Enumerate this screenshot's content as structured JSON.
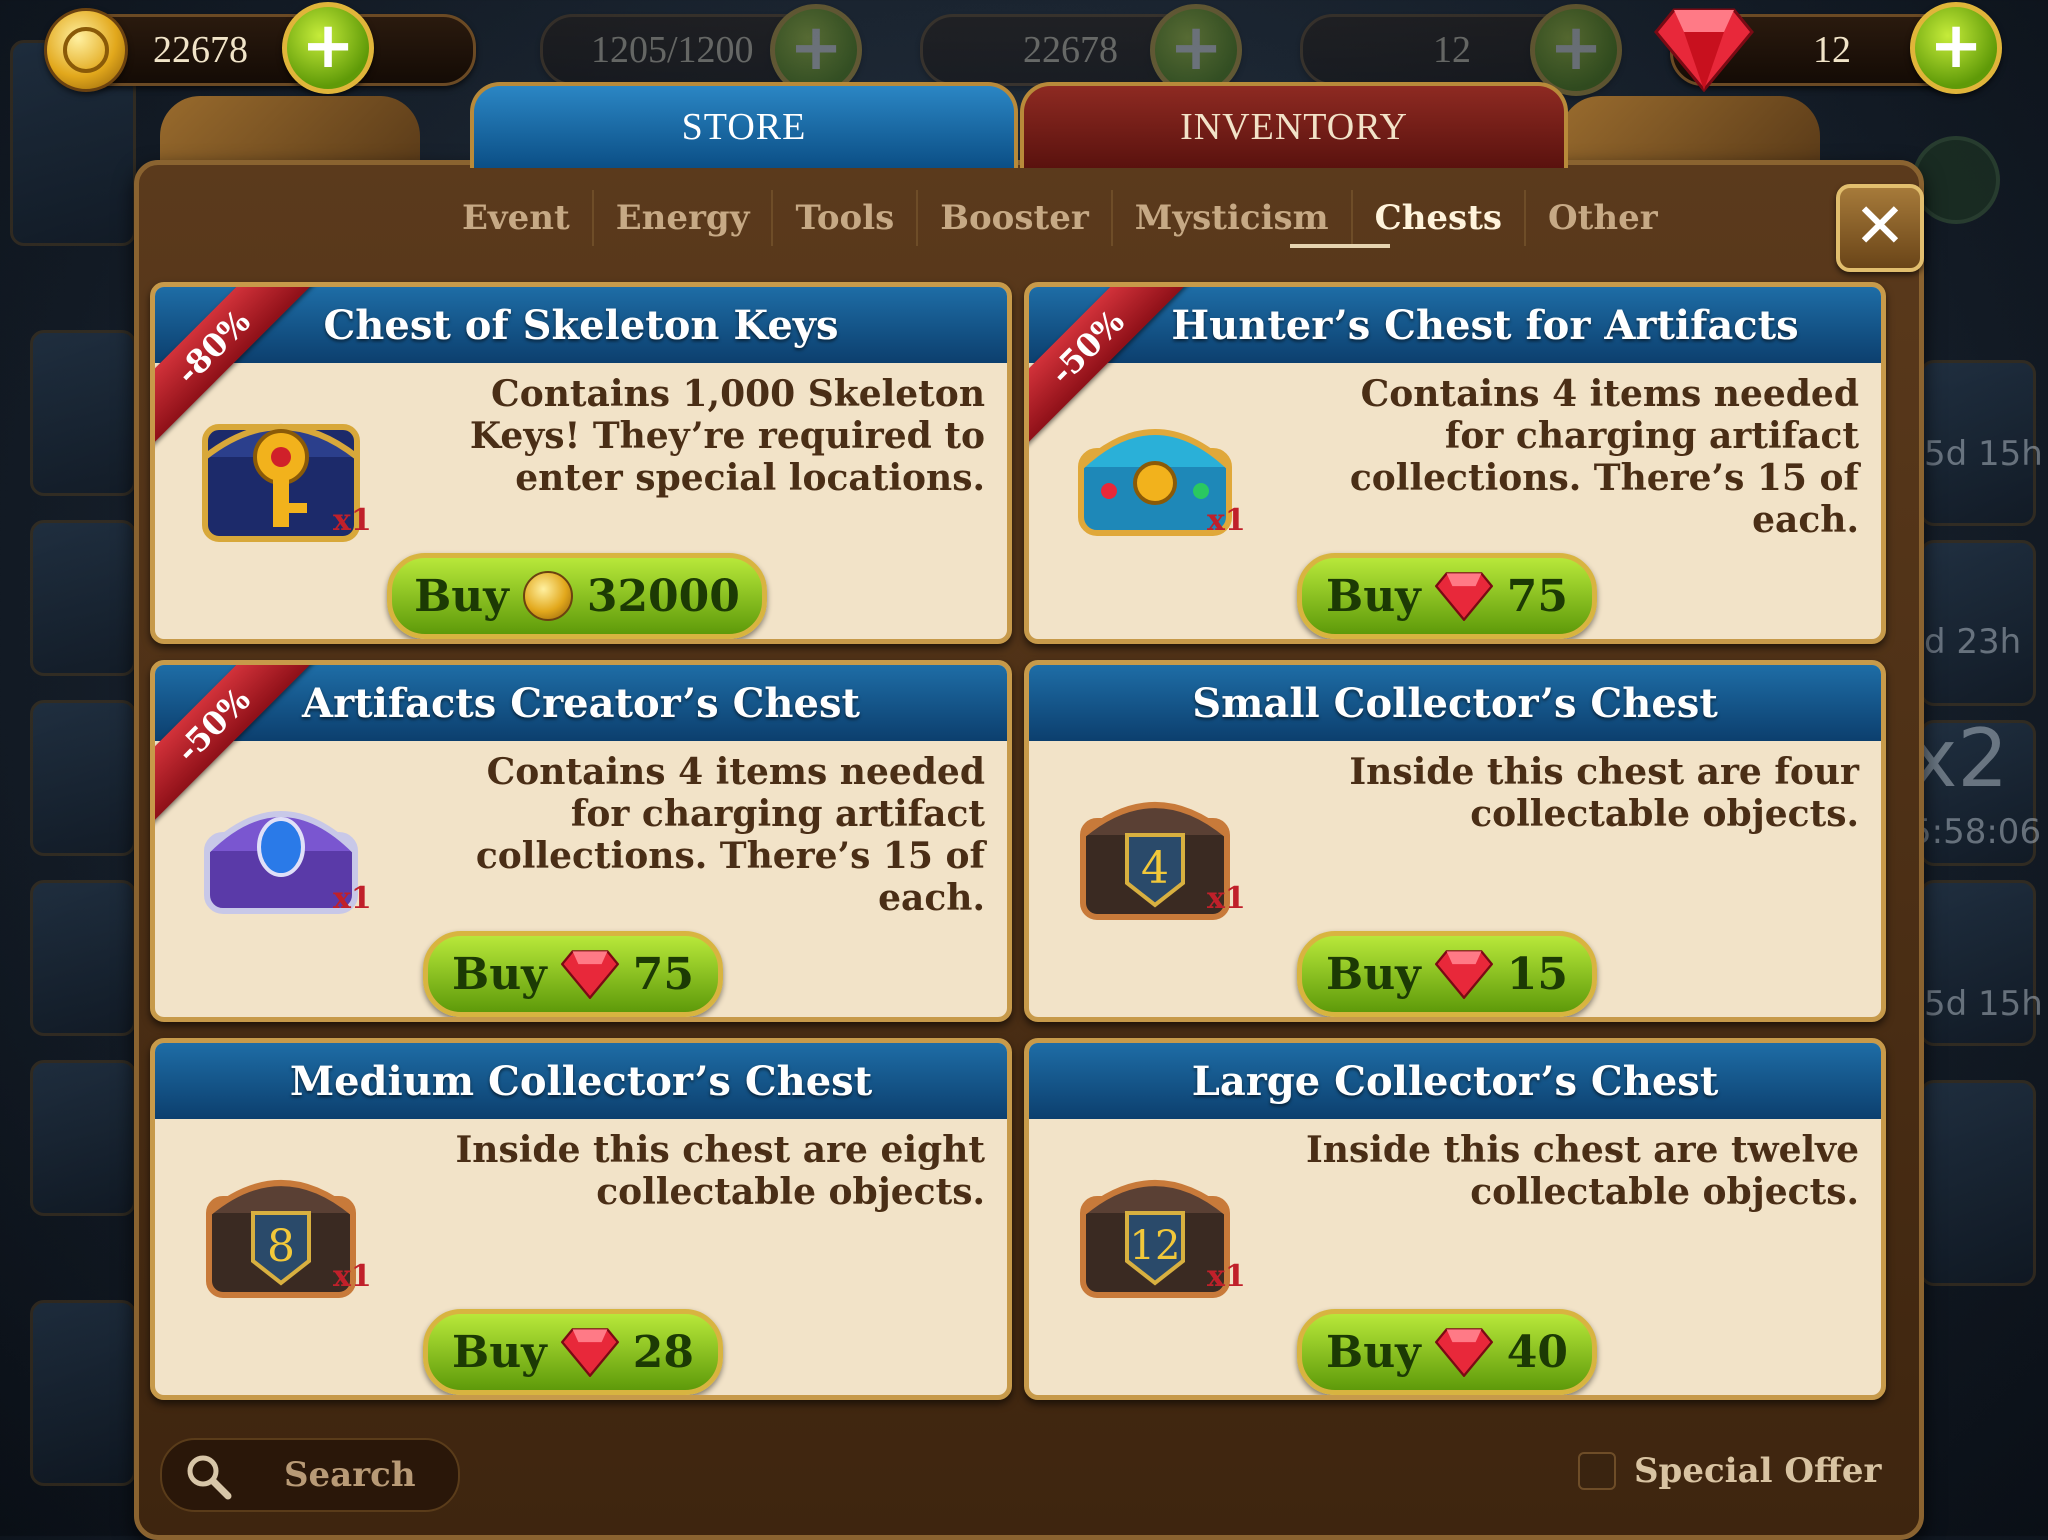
{
  "top_bar": {
    "coins": "22678",
    "energy_ghost": "1205/1200",
    "coins_ghost": "22678",
    "gems_ghost": "12",
    "gems": "12"
  },
  "tabs": {
    "store": "STORE",
    "inventory": "INVENTORY"
  },
  "subtabs": [
    "Event",
    "Energy",
    "Tools",
    "Booster",
    "Mysticism",
    "Chests",
    "Other"
  ],
  "active_subtab": "Chests",
  "background_labels": {
    "timer_1": "5d 15h",
    "timer_2": "d 23h",
    "multiplier": "x2",
    "timer_3": "5:58:06",
    "timer_4": "5d 15h"
  },
  "items": [
    {
      "title": "Chest of Skeleton Keys",
      "discount": "-80%",
      "description": "Contains 1,000 Skeleton Keys! They’re required to enter special locations.",
      "quantity": "x1",
      "buy_label": "Buy",
      "price": "32000",
      "currency_icon": "coin-icon"
    },
    {
      "title": "Hunter’s Chest for Artifacts",
      "discount": "-50%",
      "description": "Contains 4 items needed for charging artifact collections. There’s 15 of each.",
      "quantity": "x1",
      "buy_label": "Buy",
      "price": "75",
      "currency_icon": "ruby-icon"
    },
    {
      "title": "Artifacts Creator’s Chest",
      "discount": "-50%",
      "description": "Contains 4 items needed for charging artifact collections. There’s 15 of each.",
      "quantity": "x1",
      "buy_label": "Buy",
      "price": "75",
      "currency_icon": "ruby-icon"
    },
    {
      "title": "Small Collector’s Chest",
      "description": "Inside this chest are four collectable objects.",
      "chest_number": "4",
      "quantity": "x1",
      "buy_label": "Buy",
      "price": "15",
      "currency_icon": "ruby-icon"
    },
    {
      "title": "Medium Collector’s Chest",
      "description": "Inside this chest are eight collectable objects.",
      "chest_number": "8",
      "quantity": "x1",
      "buy_label": "Buy",
      "price": "28",
      "currency_icon": "ruby-icon"
    },
    {
      "title": "Large Collector’s Chest",
      "description": "Inside this chest are twelve collectable objects.",
      "chest_number": "12",
      "quantity": "x1",
      "buy_label": "Buy",
      "price": "40",
      "currency_icon": "ruby-icon"
    }
  ],
  "search": {
    "label": "Search"
  },
  "special_offer": {
    "label": "Special Offer",
    "checked": false
  },
  "colors": {
    "title_bar": "#0c3f6e",
    "card_bg": "#f2e3c8",
    "buy_green": "#7fc21a",
    "ribbon_red": "#c0202a",
    "panel_brown": "#4a2e16"
  }
}
